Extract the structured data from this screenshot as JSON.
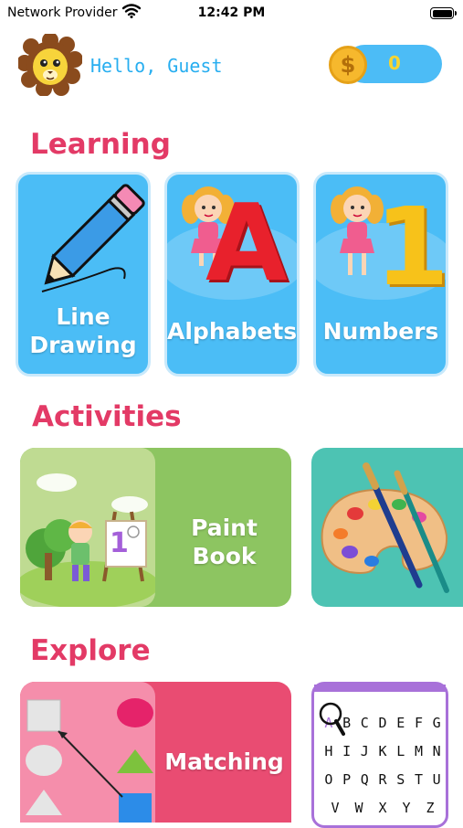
{
  "status_bar": {
    "carrier": "Network Provider",
    "time": "12:42 PM"
  },
  "header": {
    "greeting": "Hello, Guest",
    "coins": "0",
    "coin_symbol": "$"
  },
  "sections": {
    "learning": {
      "title": "Learning",
      "cards": [
        {
          "line1": "Line",
          "line2": "Drawing"
        },
        {
          "label": "Alphabets",
          "art_letter": "A"
        },
        {
          "label": "Numbers",
          "art_digit": "1"
        }
      ]
    },
    "activities": {
      "title": "Activities",
      "paint_book": {
        "label": "Paint Book",
        "easel_digit": "1"
      }
    },
    "explore": {
      "title": "Explore",
      "matching": {
        "label": "Matching"
      },
      "abc_rows": [
        [
          "A",
          "B",
          "C",
          "D",
          "E",
          "F",
          "G"
        ],
        [
          "H",
          "I",
          "J",
          "K",
          "L",
          "M",
          "N"
        ],
        [
          "O",
          "P",
          "Q",
          "R",
          "S",
          "T",
          "U"
        ],
        [
          "V",
          "W",
          "X",
          "Y",
          "Z"
        ]
      ]
    }
  },
  "colors": {
    "accent_blue": "#4bbdf6",
    "title_pink": "#e33a66",
    "paint_green": "#8dc561",
    "matching_pink": "#e94c72",
    "coin_gold": "#f6b82d"
  },
  "icons": [
    "wifi-icon",
    "battery-icon",
    "lion-avatar-icon",
    "coin-icon",
    "pencil-icon",
    "girl-icon",
    "easel-icon",
    "palette-icon",
    "square-icon",
    "circle-icon",
    "triangle-icon",
    "magnifier-icon"
  ]
}
